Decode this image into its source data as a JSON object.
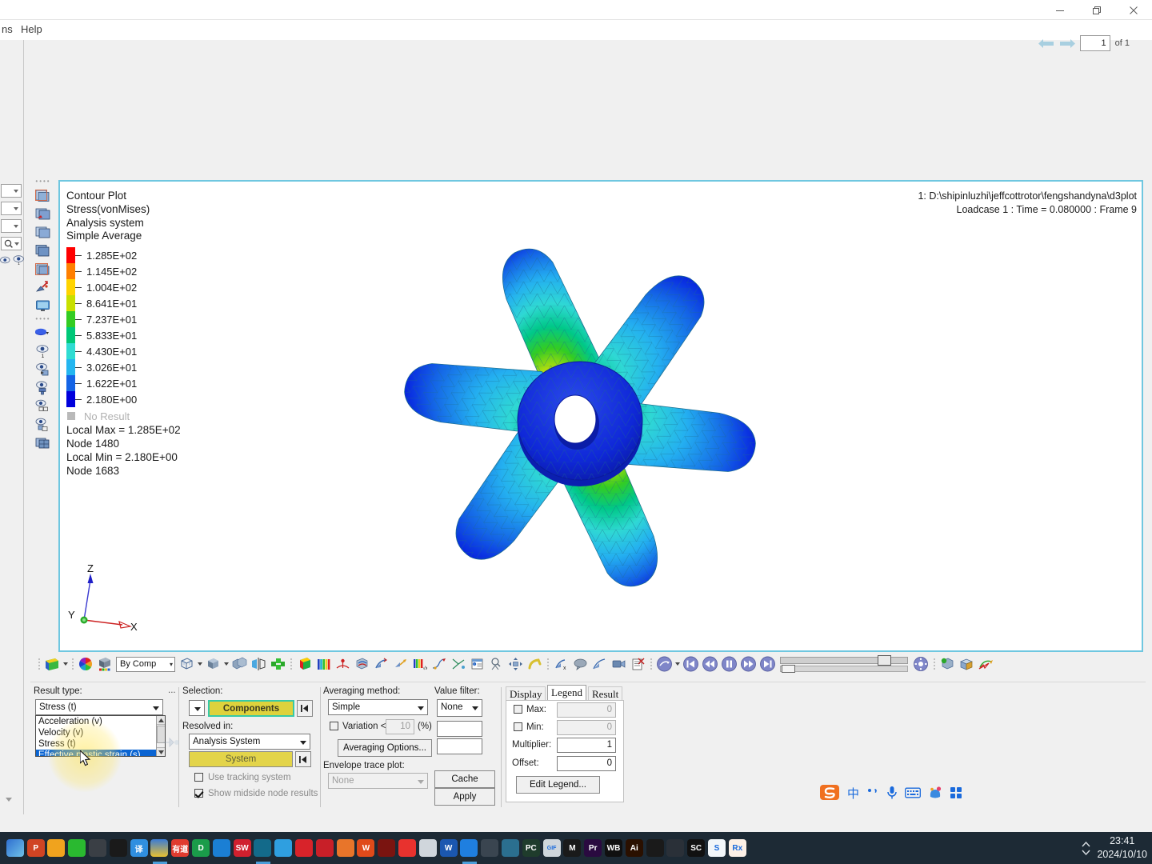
{
  "window": {
    "minimize_icon": "minimize-icon",
    "maximize_icon": "restore-icon",
    "close_icon": "close-icon"
  },
  "menubar": {
    "items": [
      {
        "label": "ns",
        "x": 0
      },
      {
        "label": "Help",
        "x": 24
      }
    ]
  },
  "pagenav": {
    "prev_icon": "arrow-left-icon",
    "next_icon": "arrow-right-icon",
    "page_value": "1",
    "of_label": "of 1"
  },
  "graphics": {
    "header_lines": [
      "Contour Plot",
      "Stress(vonMises)",
      "Analysis system",
      "Simple Average"
    ],
    "file_line": "1: D:\\shipinluzhi\\jeffcottrotor\\fengshandyna\\d3plot",
    "loadcase_line": "Loadcase 1 : Time = 0.080000 : Frame 9",
    "no_result_label": "No Result",
    "stats": [
      "Local Max =  1.285E+02",
      "Node 1480",
      "Local Min =  2.180E+00",
      "Node 1683"
    ],
    "triad": {
      "x_label": "X",
      "y_label": "Y",
      "z_label": "Z"
    }
  },
  "chart_data": {
    "type": "heatmap",
    "title": "Contour Plot",
    "subtitle": "Stress(vonMises)",
    "system": "Analysis system",
    "averaging": "Simple Average",
    "colorbar_labels": [
      "1.285E+02",
      "1.145E+02",
      "1.004E+02",
      "8.641E+01",
      "7.237E+01",
      "5.833E+01",
      "4.430E+01",
      "3.026E+01",
      "1.622E+01",
      "2.180E+00"
    ],
    "colorbar_values": [
      128.5,
      114.5,
      100.4,
      86.41,
      72.37,
      58.33,
      44.3,
      30.26,
      16.22,
      2.18
    ],
    "colorbar_colors": [
      "#ff0000",
      "#ff7f00",
      "#ffd400",
      "#c8e000",
      "#33cc22",
      "#00c878",
      "#2fdcd2",
      "#24b6f0",
      "#1464e6",
      "#0000dc"
    ],
    "no_result_color": "#b9b9b9",
    "local_max": 128.5,
    "local_max_node": 1480,
    "local_min": 2.18,
    "local_min_node": 1683,
    "units_multiplier": 1,
    "units_offset": 0,
    "legend_position": "top-left",
    "model": "six-blade fan rotor with central hub ring, triangular shell mesh"
  },
  "toolbar": {
    "by_comp_label": "By Comp",
    "icons": [
      "contour-plot-icon",
      "color-wheel-icon",
      "component-color-icon",
      "mesh-view-icon",
      "solid-view-icon",
      "section-cut-icon",
      "mirror-icon",
      "assembly-icon",
      "legend-bar-icon",
      "histogram-icon",
      "anchor-icon",
      "iso-view-icon",
      "deformed-shape-icon",
      "vector-plot-icon",
      "tensor-plot-icon",
      "math-result-icon",
      "stream-trace-icon",
      "tracing-icon",
      "note-icon",
      "query-icon",
      "measure-icon",
      "free-body-icon",
      "derived-result-icon",
      "annotate-icon",
      "deform-icon",
      "video-icon",
      "report-icon",
      "animate-icon",
      "first-frame-icon",
      "rewind-icon",
      "pause-icon",
      "forward-icon",
      "last-frame-icon",
      "animation-settings-icon",
      "import-icon",
      "export-icon",
      "plot-export-icon"
    ]
  },
  "panel": {
    "result_type": {
      "label": "Result type:",
      "ellipsis": "...",
      "value": "Stress (t)",
      "options": [
        "Acceleration (v)",
        "Velocity (v)",
        "Stress (t)",
        "Effective plastic strain (s)"
      ],
      "selected_option": "Effective plastic strain (s)"
    },
    "selection": {
      "label": "Selection:",
      "components_button": "Components",
      "resolved_in_label": "Resolved in:",
      "resolved_in_value": "Analysis System",
      "system_button": "System",
      "use_tracking_system": {
        "label": "Use tracking system",
        "checked": false
      },
      "show_midside_node_results": {
        "label": "Show midside node results",
        "checked": true
      }
    },
    "averaging": {
      "label": "Averaging method:",
      "value": "Simple",
      "variation_label": "Variation <",
      "variation_value": "10",
      "variation_unit": "(%)",
      "variation_checked": false,
      "options_button": "Averaging Options...",
      "envelope_label": "Envelope trace plot:",
      "envelope_value": "None"
    },
    "value_filter": {
      "label": "Value filter:",
      "value": "None",
      "field_1": "",
      "field_2": ""
    },
    "actions": {
      "cache_button": "Cache",
      "apply_button": "Apply"
    },
    "tabs": {
      "items": [
        "Display",
        "Legend",
        "Result"
      ],
      "selected": "Legend"
    },
    "legend_tab": {
      "max_label": "Max:",
      "max_value": "0",
      "max_checked": false,
      "min_label": "Min:",
      "min_value": "0",
      "min_checked": false,
      "multiplier_label": "Multiplier:",
      "multiplier_value": "1",
      "offset_label": "Offset:",
      "offset_value": "0",
      "edit_legend_button": "Edit Legend..."
    }
  },
  "ime": {
    "logo": "sogou-logo-icon",
    "mode": "中",
    "punctuation_icon": "punctuation-icon",
    "voice_icon": "microphone-icon",
    "keyboard_icon": "keyboard-icon",
    "skin_icon": "skin-icon",
    "toolbox_icon": "toolbox-icon"
  },
  "taskbar": {
    "icons": [
      {
        "name": "ie-icon",
        "glyph": "",
        "bg": "linear-gradient(135deg,#2f6fd0,#6fc2e8)",
        "running": false
      },
      {
        "name": "powerpoint-icon",
        "glyph": "P",
        "bg": "#d04423",
        "running": false
      },
      {
        "name": "office-icon",
        "glyph": "",
        "bg": "#f0a31e",
        "running": false
      },
      {
        "name": "wechat-icon",
        "glyph": "",
        "bg": "#2ab930",
        "running": false
      },
      {
        "name": "unity-icon",
        "glyph": "",
        "bg": "#3a3f45",
        "running": false
      },
      {
        "name": "recorder-icon",
        "glyph": "",
        "bg": "#1a1a1a",
        "running": false
      },
      {
        "name": "translate-icon",
        "glyph": "译",
        "bg": "#2f8fe0",
        "running": false
      },
      {
        "name": "foxmail-icon",
        "glyph": "",
        "bg": "linear-gradient(180deg,#3a7bd5,#e8c030)",
        "running": true
      },
      {
        "name": "youdao-icon",
        "glyph": "有道",
        "bg": "#e03b2f",
        "running": false
      },
      {
        "name": "dingtalk-doc-icon",
        "glyph": "D",
        "bg": "#1a9c4a",
        "running": false
      },
      {
        "name": "xmind-icon",
        "glyph": "",
        "bg": "#1b7fd4",
        "running": false
      },
      {
        "name": "solidworks-icon",
        "glyph": "SW",
        "bg": "#d0202e",
        "running": false
      },
      {
        "name": "altair-icon",
        "glyph": "",
        "bg": "#136a8a",
        "running": true
      },
      {
        "name": "edge-icon",
        "glyph": "",
        "bg": "#2f9fe0",
        "running": false
      },
      {
        "name": "ansys-icon",
        "glyph": "",
        "bg": "#d8232a",
        "running": false
      },
      {
        "name": "ansys-wb-icon",
        "glyph": "",
        "bg": "#c81f28",
        "running": false
      },
      {
        "name": "matlab-icon",
        "glyph": "",
        "bg": "#e8752a",
        "running": false
      },
      {
        "name": "wps-icon",
        "glyph": "W",
        "bg": "#e04a1a",
        "running": false
      },
      {
        "name": "acrobat-icon",
        "glyph": "",
        "bg": "#7a1410",
        "running": false
      },
      {
        "name": "netease-music-icon",
        "glyph": "",
        "bg": "#e8322e",
        "running": false
      },
      {
        "name": "screenshot-icon",
        "glyph": "",
        "bg": "#d0d6dc",
        "running": false
      },
      {
        "name": "word-icon",
        "glyph": "W",
        "bg": "#1b57b0",
        "running": false
      },
      {
        "name": "player-icon",
        "glyph": "",
        "bg": "#1f7fe0",
        "running": true
      },
      {
        "name": "excel-grid-icon",
        "glyph": "",
        "bg": "#3a4550",
        "running": false
      },
      {
        "name": "security-icon",
        "glyph": "",
        "bg": "#2b6f8f",
        "running": false
      },
      {
        "name": "pycharm-icon",
        "glyph": "PC",
        "bg": "#1f3c2c",
        "running": false
      },
      {
        "name": "gif-tool-icon",
        "glyph": "GIF",
        "bg": "#cfd6dc",
        "running": false
      },
      {
        "name": "maya-icon",
        "glyph": "M",
        "bg": "#1a1a1a",
        "running": false
      },
      {
        "name": "premiere-icon",
        "glyph": "Pr",
        "bg": "#2a0a40",
        "running": false
      },
      {
        "name": "workbench-icon",
        "glyph": "WB",
        "bg": "#101010",
        "running": false
      },
      {
        "name": "illustrator-icon",
        "glyph": "Ai",
        "bg": "#2a1000",
        "running": false
      },
      {
        "name": "autodesk-icon",
        "glyph": "",
        "bg": "#1a1a1a",
        "running": false
      },
      {
        "name": "office-apps-icon",
        "glyph": "",
        "bg": "#2a3038",
        "running": false
      },
      {
        "name": "sc-player-icon",
        "glyph": "SC",
        "bg": "#111111",
        "running": false
      },
      {
        "name": "sogou-browser-icon",
        "glyph": "S",
        "bg": "#f2f6f9",
        "running": false
      },
      {
        "name": "rx-icon",
        "glyph": "Rx",
        "bg": "#fdf0e6",
        "running": false
      }
    ],
    "chevron_up_icon": "chevron-up-icon",
    "chevron_down_icon": "chevron-down-icon",
    "time": "23:41",
    "date": "2024/10/10"
  }
}
